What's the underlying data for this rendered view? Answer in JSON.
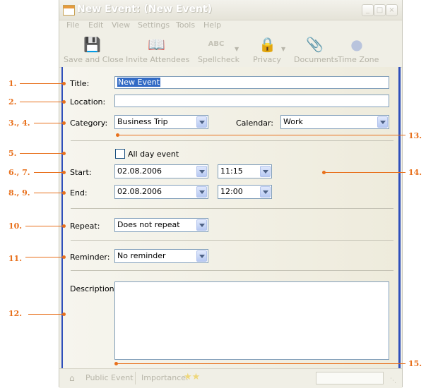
{
  "window": {
    "title": "New Event: (New Event)",
    "controls": [
      "_",
      "□",
      "×"
    ]
  },
  "menu": [
    "File",
    "Edit",
    "View",
    "Settings",
    "Tools",
    "Help"
  ],
  "toolbar": [
    {
      "label": "Save and Close",
      "icon": "save-close-icon"
    },
    {
      "label": "Invite Attendees",
      "icon": "invite-icon"
    },
    {
      "label": "Spellcheck",
      "icon": "spellcheck-icon",
      "icon_text": "ABC"
    },
    {
      "label": "Privacy",
      "icon": "lock-icon"
    },
    {
      "label": "Documents",
      "icon": "paperclip-icon"
    },
    {
      "label": "Time Zone",
      "icon": "globe-icon"
    }
  ],
  "form": {
    "title_label": "Title:",
    "title_value": "New Event",
    "location_label": "Location:",
    "location_value": "",
    "category_label": "Category:",
    "category_value": "Business Trip",
    "calendar_label": "Calendar:",
    "calendar_value": "Work",
    "all_day_label": "All day event",
    "all_day_checked": false,
    "start_label": "Start:",
    "start_date": "02.08.2006",
    "start_time": "11:15",
    "end_label": "End:",
    "end_date": "02.08.2006",
    "end_time": "12:00",
    "repeat_label": "Repeat:",
    "repeat_value": "Does not repeat",
    "reminder_label": "Reminder:",
    "reminder_value": "No reminder",
    "description_label": "Description:",
    "description_value": ""
  },
  "status": {
    "public_event": "Public Event",
    "importance": "Importance:",
    "importance_stars": "★★"
  },
  "annotations": {
    "n1": "1.",
    "n2": "2.",
    "n3": "3., 4.",
    "n5": "5.",
    "n6": "6., 7.",
    "n8": "8., 9.",
    "n10": "10.",
    "n11": "11.",
    "n12": "12.",
    "n13": "13.",
    "n14": "14.",
    "n15": "15.",
    "color": "#e8701c"
  },
  "colors": {
    "accent_border": "#2f4fbb",
    "selection": "#316ac5",
    "input_border": "#7f9db9"
  }
}
